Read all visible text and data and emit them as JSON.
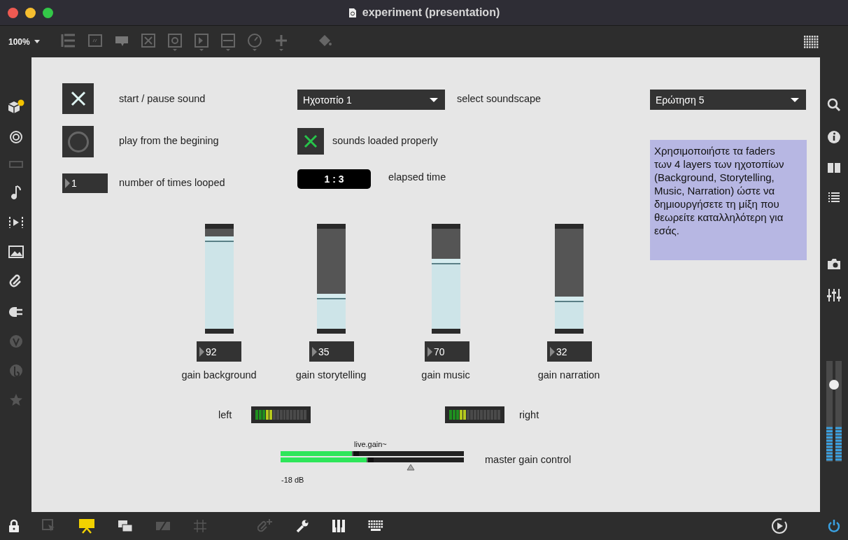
{
  "window": {
    "title": "experiment (presentation)"
  },
  "toolbar": {
    "zoom": "100%"
  },
  "presentation_mode": true,
  "controls": {
    "play_toggle": {
      "checked": true,
      "label": "start / pause sound"
    },
    "restart_button": {
      "label": "play from the begining"
    },
    "loop_count": {
      "value": "1",
      "label": "number of times looped"
    },
    "soundscape_menu": {
      "value": "Ηχοτοπίο 1",
      "label": "select soundscape"
    },
    "loaded_toggle": {
      "checked": true,
      "label": "sounds loaded properly"
    },
    "elapsed": {
      "value": "1 : 3",
      "label": "elapsed time"
    },
    "question_menu": {
      "value": "Ερώτηση 5"
    },
    "instructions": "Χρησιμοποιήστε τα faders των 4 layers των ηχοτοπίων (Background, Storytelling, Music, Narration) ώστε να δημιουργήσετε τη μίξη που θεωρείτε καταλληλότερη για εσάς."
  },
  "faders": [
    {
      "label": "gain background",
      "value": "92",
      "level": 0.92
    },
    {
      "label": "gain storytelling",
      "value": "35",
      "level": 0.35
    },
    {
      "label": "gain music",
      "value": "70",
      "level": 0.7
    },
    {
      "label": "gain narration",
      "value": "32",
      "level": 0.32
    }
  ],
  "meters": [
    {
      "label": "left",
      "level": 0.33
    },
    {
      "label": "right",
      "level": 0.33
    }
  ],
  "master_gain": {
    "title": "live.gain~",
    "label": "master gain control",
    "reading": "-18 dB",
    "channels": [
      {
        "level": 0.39
      },
      {
        "level": 0.47
      }
    ]
  }
}
